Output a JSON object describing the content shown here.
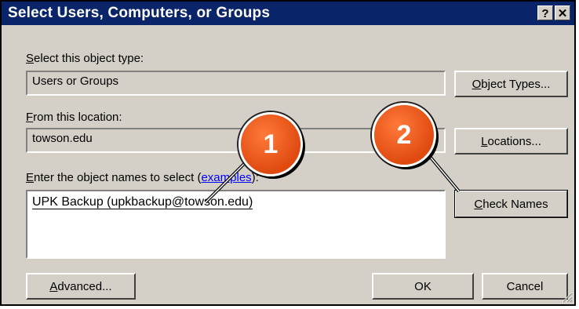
{
  "window": {
    "title": "Select Users, Computers, or Groups",
    "help_glyph": "?",
    "close_glyph": "✕"
  },
  "object_type": {
    "label": "Select this object type:",
    "value": "Users or Groups",
    "button": "Object Types..."
  },
  "location": {
    "label": "From this location:",
    "value": "towson.edu",
    "button": "Locations..."
  },
  "names": {
    "label_prefix": "Enter the object names to select (",
    "label_link": "examples",
    "label_suffix": "):",
    "value": "UPK Backup (upkbackup@towson.edu)",
    "check_button": "Check Names"
  },
  "footer": {
    "advanced": "Advanced...",
    "ok": "OK",
    "cancel": "Cancel"
  },
  "callouts": {
    "one": "1",
    "two": "2",
    "color": "#e8531a"
  }
}
